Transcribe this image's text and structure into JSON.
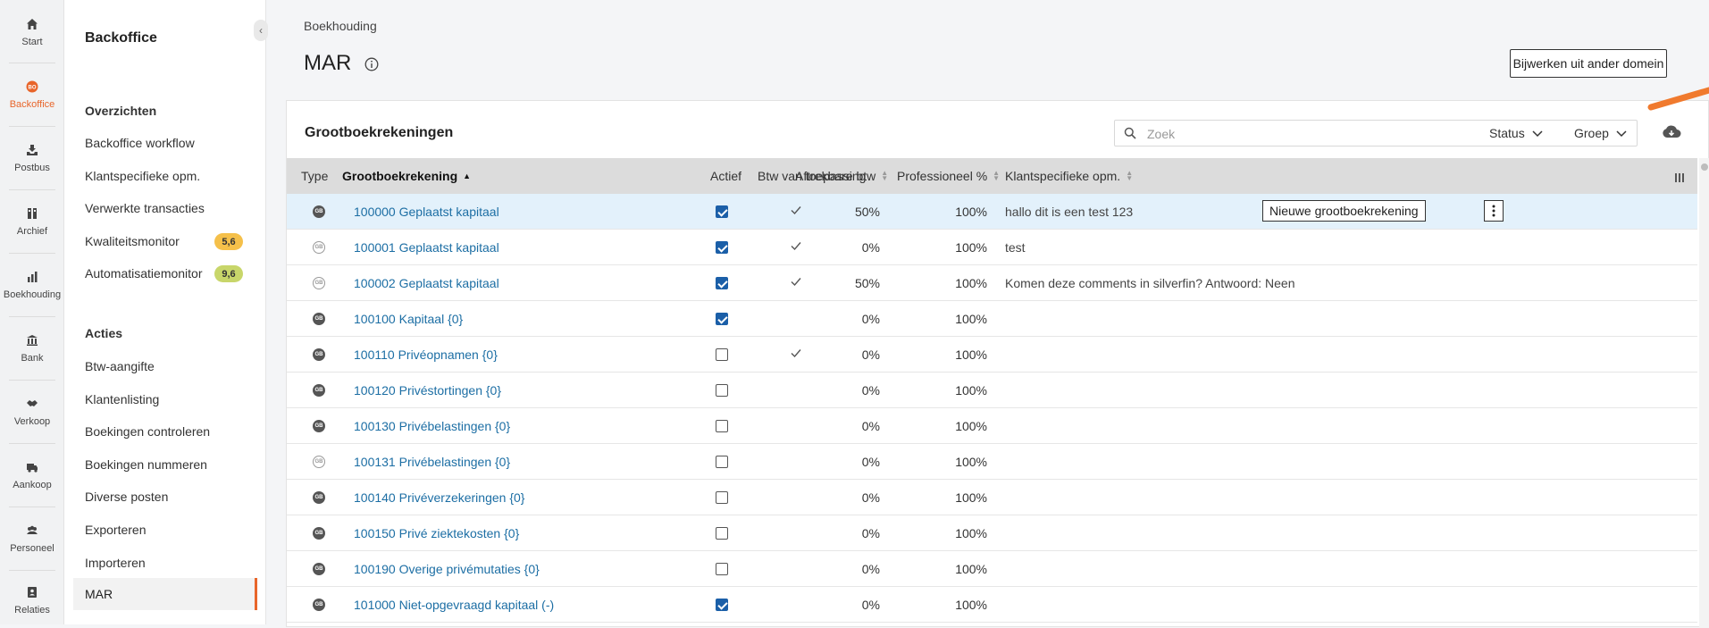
{
  "rail": {
    "items": [
      {
        "label": "Start",
        "icon": "home-icon"
      },
      {
        "label": "Backoffice",
        "icon": "backoffice-icon",
        "active": true
      },
      {
        "label": "Postbus",
        "icon": "inbox-icon"
      },
      {
        "label": "Archief",
        "icon": "archive-icon"
      },
      {
        "label": "Boekhouding",
        "icon": "bar-chart-icon"
      },
      {
        "label": "Bank",
        "icon": "bank-icon"
      },
      {
        "label": "Verkoop",
        "icon": "handshake-icon"
      },
      {
        "label": "Aankoop",
        "icon": "truck-icon"
      },
      {
        "label": "Personeel",
        "icon": "people-icon"
      },
      {
        "label": "Relaties",
        "icon": "contacts-icon"
      }
    ]
  },
  "sidebar": {
    "title": "Backoffice",
    "overview_heading": "Overzichten",
    "overview_items": [
      "Backoffice workflow",
      "Klantspecifieke opm.",
      "Verwerkte transacties",
      "Kwaliteitsmonitor",
      "Automatisatiemonitor"
    ],
    "badges": {
      "quality": "5,6",
      "automation": "9,6"
    },
    "badge_colors": {
      "quality": "#f5c04a",
      "automation": "#c8d66a"
    },
    "actions_heading": "Acties",
    "action_items": [
      "Btw-aangifte",
      "Klantenlisting",
      "Boekingen controleren",
      "Boekingen nummeren",
      "Diverse posten",
      "Exporteren",
      "Importeren",
      "MAR"
    ]
  },
  "header": {
    "breadcrumb": "Boekhouding",
    "title": "MAR",
    "update_button": "Bijwerken uit ander domein"
  },
  "card": {
    "title": "Grootboekrekeningen",
    "search_placeholder": "Zoek",
    "filter_status": "Status",
    "filter_group": "Groep"
  },
  "table": {
    "columns": [
      "Type",
      "Grootboekrekening",
      "Actief",
      "Btw van toepassing",
      "Aftrekbare btw",
      "Professioneel %",
      "Klantspecifieke opm."
    ],
    "new_account_button": "Nieuwe grootboekrekening",
    "rows": [
      {
        "type": "GB",
        "filled": true,
        "name": "100000 Geplaatst kapitaal",
        "active": true,
        "btw": true,
        "aftrekbaar": "50%",
        "prof": "100%",
        "opm": "hallo dit is een test 123",
        "selected": true
      },
      {
        "type": "GB",
        "filled": false,
        "name": "100001 Geplaatst kapitaal",
        "active": true,
        "btw": true,
        "aftrekbaar": "0%",
        "prof": "100%",
        "opm": "test"
      },
      {
        "type": "GB",
        "filled": false,
        "name": "100002 Geplaatst kapitaal",
        "active": true,
        "btw": true,
        "aftrekbaar": "50%",
        "prof": "100%",
        "opm": "Komen deze comments in silverfin? Antwoord: Neen"
      },
      {
        "type": "GB",
        "filled": true,
        "name": "100100 Kapitaal {0}",
        "active": true,
        "btw": false,
        "aftrekbaar": "0%",
        "prof": "100%",
        "opm": ""
      },
      {
        "type": "GB",
        "filled": true,
        "name": "100110 Privéopnamen {0}",
        "active": false,
        "btw": true,
        "aftrekbaar": "0%",
        "prof": "100%",
        "opm": ""
      },
      {
        "type": "GB",
        "filled": true,
        "name": "100120 Privéstortingen {0}",
        "active": false,
        "btw": false,
        "aftrekbaar": "0%",
        "prof": "100%",
        "opm": ""
      },
      {
        "type": "GB",
        "filled": true,
        "name": "100130 Privébelastingen {0}",
        "active": false,
        "btw": false,
        "aftrekbaar": "0%",
        "prof": "100%",
        "opm": ""
      },
      {
        "type": "GB",
        "filled": false,
        "name": "100131 Privébelastingen {0}",
        "active": false,
        "btw": false,
        "aftrekbaar": "0%",
        "prof": "100%",
        "opm": ""
      },
      {
        "type": "GB",
        "filled": true,
        "name": "100140 Privéverzekeringen {0}",
        "active": false,
        "btw": false,
        "aftrekbaar": "0%",
        "prof": "100%",
        "opm": ""
      },
      {
        "type": "GB",
        "filled": true,
        "name": "100150 Privé ziektekosten {0}",
        "active": false,
        "btw": false,
        "aftrekbaar": "0%",
        "prof": "100%",
        "opm": ""
      },
      {
        "type": "GB",
        "filled": true,
        "name": "100190 Overige privémutaties {0}",
        "active": false,
        "btw": false,
        "aftrekbaar": "0%",
        "prof": "100%",
        "opm": ""
      },
      {
        "type": "GB",
        "filled": true,
        "name": "101000 Niet-opgevraagd kapitaal (-)",
        "active": true,
        "btw": false,
        "aftrekbaar": "0%",
        "prof": "100%",
        "opm": ""
      }
    ]
  },
  "colors": {
    "accent": "#e8652a",
    "link": "#1c6ea4",
    "checkbox": "#1b5fa8",
    "selected_row": "#e3f1fb"
  }
}
